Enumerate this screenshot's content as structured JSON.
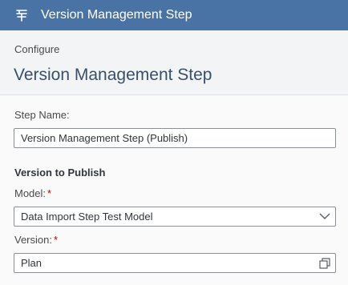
{
  "titlebar": {
    "title": "Version Management Step",
    "icon": "step-icon"
  },
  "header": {
    "breadcrumb": "Configure",
    "title": "Version Management Step"
  },
  "form": {
    "step_name_label": "Step Name:",
    "step_name_value": "Version Management Step (Publish)",
    "section_title": "Version to Publish",
    "model_label": "Model:",
    "model_value": "Data Import Step Test Model",
    "model_icon": "chevron-down-icon",
    "version_label": "Version:",
    "version_value": "Plan",
    "version_icon": "value-help-icon",
    "required_marker": "*"
  },
  "colors": {
    "titlebar_bg": "#4a73a5",
    "required": "#bb0000",
    "title_text": "#3a4f6a"
  }
}
